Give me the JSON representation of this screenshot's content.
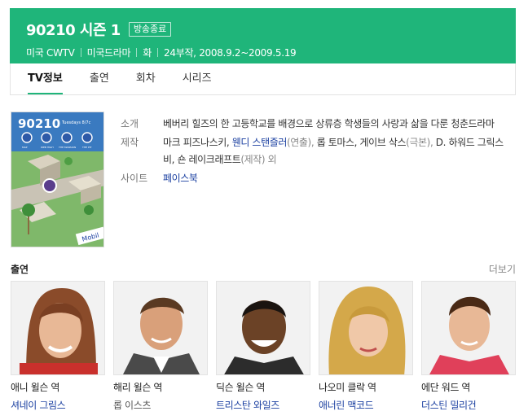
{
  "header": {
    "title": "90210 시즌 1",
    "badge": "방송종료",
    "meta": [
      "미국 CWTV",
      "미국드라마",
      "화",
      "24부작, 2008.9.2~2009.5.19"
    ]
  },
  "tabs": [
    {
      "label": "TV정보",
      "active": true
    },
    {
      "label": "출연",
      "active": false
    },
    {
      "label": "회차",
      "active": false
    },
    {
      "label": "시리즈",
      "active": false
    }
  ],
  "poster": {
    "logo_text": "90210",
    "tagline": "Tuesdays 8/7c",
    "sign_text": "Mobil",
    "nav_labels": [
      "MAP",
      "WEB HIGH",
      "THE MANSION",
      "THE PIT"
    ]
  },
  "info": {
    "intro_label": "소개",
    "intro_text": "베버리 힐즈의 한 고등학교를 배경으로 상류층 학생들의 사랑과 삶을 다룬 청춘드라마",
    "production_label": "제작",
    "production": {
      "p1": "마크 피즈나스키,",
      "p2": "웬디 스탠즐러",
      "p3": "(연출),",
      "p4": "롭 토마스, 게이브 삭스",
      "p5": "(극본),",
      "p6": "D. 하워드 그릭스비, 숀 레이크래프트",
      "p7": "(제작) 외"
    },
    "site_label": "사이트",
    "site_link": "페이스북"
  },
  "cast_section": {
    "title": "출연",
    "more": "더보기"
  },
  "cast": [
    {
      "role": "애니 윌슨 역",
      "actor": "셔네이 그림스",
      "linked": true
    },
    {
      "role": "해리 윌슨 역",
      "actor": "롭 이스츠",
      "linked": false
    },
    {
      "role": "딕슨 윌슨 역",
      "actor": "트리스탄 와일즈",
      "linked": true
    },
    {
      "role": "나오미 클락 역",
      "actor": "애너린 맥코드",
      "linked": true
    },
    {
      "role": "에단 워드 역",
      "actor": "더스틴 밀리건",
      "linked": true
    }
  ],
  "colors": {
    "brand": "#1fb57a",
    "link": "#1a3fa0"
  }
}
